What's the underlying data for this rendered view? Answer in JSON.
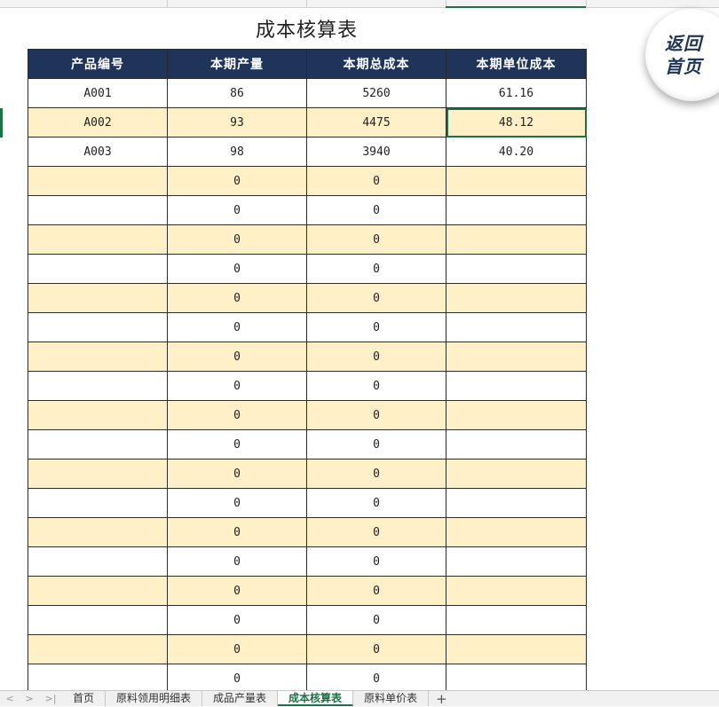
{
  "sheet_title": "成本核算表",
  "return_button": {
    "line1": "返回",
    "line2": "首页"
  },
  "table": {
    "headers": [
      "产品编号",
      "本期产量",
      "本期总成本",
      "本期单位成本"
    ],
    "rows": [
      [
        "A001",
        "86",
        "5260",
        "61.16"
      ],
      [
        "A002",
        "93",
        "4475",
        "48.12"
      ],
      [
        "A003",
        "98",
        "3940",
        "40.20"
      ],
      [
        "",
        "0",
        "0",
        ""
      ],
      [
        "",
        "0",
        "0",
        ""
      ],
      [
        "",
        "0",
        "0",
        ""
      ],
      [
        "",
        "0",
        "0",
        ""
      ],
      [
        "",
        "0",
        "0",
        ""
      ],
      [
        "",
        "0",
        "0",
        ""
      ],
      [
        "",
        "0",
        "0",
        ""
      ],
      [
        "",
        "0",
        "0",
        ""
      ],
      [
        "",
        "0",
        "0",
        ""
      ],
      [
        "",
        "0",
        "0",
        ""
      ],
      [
        "",
        "0",
        "0",
        ""
      ],
      [
        "",
        "0",
        "0",
        ""
      ],
      [
        "",
        "0",
        "0",
        ""
      ],
      [
        "",
        "0",
        "0",
        ""
      ],
      [
        "",
        "0",
        "0",
        ""
      ],
      [
        "",
        "0",
        "0",
        ""
      ],
      [
        "",
        "0",
        "0",
        ""
      ],
      [
        "",
        "0",
        "0",
        ""
      ]
    ],
    "active_cell": {
      "row": 1,
      "col": 3
    }
  },
  "sheet_nav": {
    "first": "<",
    "prev": ">",
    "last": ">|"
  },
  "sheet_tabs": [
    {
      "label": "首页",
      "active": false
    },
    {
      "label": "原料领用明细表",
      "active": false
    },
    {
      "label": "成品产量表",
      "active": false
    },
    {
      "label": "成本核算表",
      "active": true
    },
    {
      "label": "原料单价表",
      "active": false
    }
  ],
  "add_sheet_label": "+",
  "colors": {
    "header_bg": "#1f3459",
    "stripe_bg": "#fff0c8",
    "selection": "#1e7145"
  }
}
